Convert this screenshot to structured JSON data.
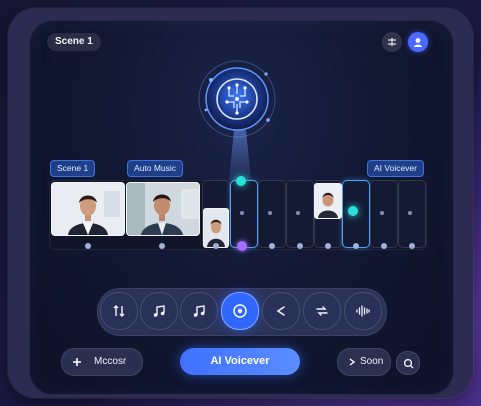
{
  "header": {
    "scene_label": "Scene 1",
    "settings_icon": "sliders-icon",
    "avatar_icon": "assistant-avatar-icon"
  },
  "hero": {
    "icon": "ai-brain-circuit-icon",
    "accent": "#29e0d8"
  },
  "timeline": {
    "labels": {
      "scene": "Scene 1",
      "music": "Auto Music",
      "voice": "AI Voicever"
    },
    "clips": [
      "clip-man-portrait-1",
      "clip-man-portrait-2"
    ],
    "slots": 8,
    "accent": "#4aa4ff"
  },
  "toolbar": {
    "tools": [
      {
        "name": "trim-icon"
      },
      {
        "name": "music-note-icon"
      },
      {
        "name": "music-note-icon"
      },
      {
        "name": "record-icon",
        "active": true
      },
      {
        "name": "share-icon"
      },
      {
        "name": "transition-icon"
      },
      {
        "name": "waveform-icon"
      }
    ]
  },
  "footer": {
    "add_label": "Mccosr",
    "voice_button": "AI Voicever",
    "soon_label": "Soon",
    "primary_color": "#3f71ff"
  }
}
